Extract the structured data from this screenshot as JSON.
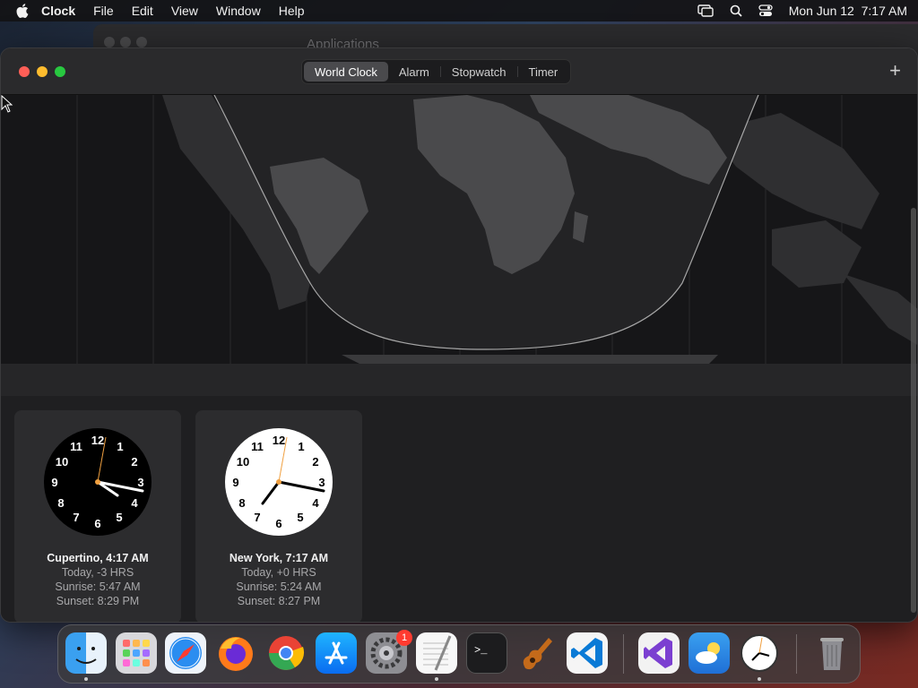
{
  "menubar": {
    "app_name": "Clock",
    "items": [
      "File",
      "Edit",
      "View",
      "Window",
      "Help"
    ],
    "datetime": "Mon Jun 12  7:17 AM"
  },
  "background_window": {
    "title": "Applications"
  },
  "window": {
    "tabs": [
      {
        "label": "World Clock",
        "active": true
      },
      {
        "label": "Alarm",
        "active": false
      },
      {
        "label": "Stopwatch",
        "active": false
      },
      {
        "label": "Timer",
        "active": false
      }
    ],
    "add_label": "+"
  },
  "clocks": [
    {
      "city_time": "Cupertino, 4:17 AM",
      "offset": "Today, -3 HRS",
      "sunrise": "Sunrise: 5:47 AM",
      "sunset": "Sunset: 8:29 PM",
      "theme": "dark",
      "numbers": [
        "12",
        "1",
        "2",
        "3",
        "4",
        "5",
        "6",
        "7",
        "8",
        "9",
        "10",
        "11"
      ]
    },
    {
      "city_time": "New York, 7:17 AM",
      "offset": "Today, +0 HRS",
      "sunrise": "Sunrise: 5:24 AM",
      "sunset": "Sunset: 8:27 PM",
      "theme": "light",
      "numbers": [
        "12",
        "1",
        "2",
        "3",
        "4",
        "5",
        "6",
        "7",
        "8",
        "9",
        "10",
        "11"
      ]
    }
  ],
  "dock": {
    "apps": [
      "finder-icon",
      "launchpad-icon",
      "safari-icon",
      "firefox-icon",
      "chrome-icon",
      "app-store-icon",
      "system-settings-icon",
      "textedit-icon",
      "terminal-icon",
      "garageband-icon",
      "vscode-icon",
      "visual-studio-icon",
      "weather-icon",
      "clock-icon",
      "trash-icon"
    ],
    "settings_badge": "1"
  },
  "colors": {
    "accent_second_hand": "#f0a040",
    "close": "#ff5f57",
    "minimize": "#febc2e",
    "maximize": "#28c840"
  }
}
